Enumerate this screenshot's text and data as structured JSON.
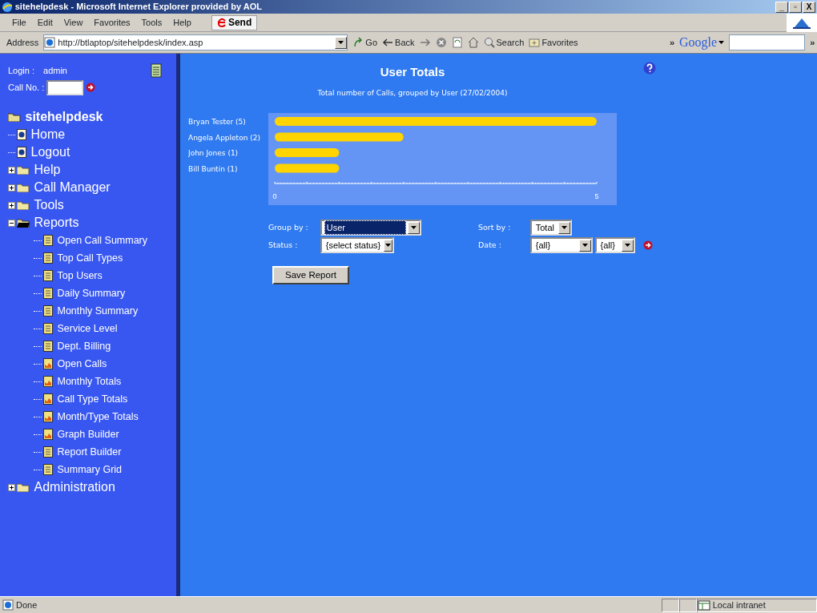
{
  "window": {
    "title": "sitehelpdesk - Microsoft Internet Explorer provided by AOL",
    "controls": [
      "_",
      "▫",
      "X"
    ]
  },
  "menu": [
    "File",
    "Edit",
    "View",
    "Favorites",
    "Tools",
    "Help"
  ],
  "send_button": "Send",
  "address_bar": {
    "label": "Address",
    "url": "http://btlaptop/sitehelpdesk/index.asp",
    "go": "Go",
    "back": "Back",
    "search": "Search",
    "favorites": "Favorites",
    "more": "»",
    "google": "Google",
    "google_more": "»"
  },
  "sidebar": {
    "login_label": "Login :",
    "login_value": "admin",
    "callno_label": "Call No. :",
    "tree": {
      "label": "sitehelpdesk",
      "children": [
        {
          "label": "Home",
          "kind": "page"
        },
        {
          "label": "Logout",
          "kind": "page"
        },
        {
          "label": "Help",
          "kind": "folder",
          "expanded": false
        },
        {
          "label": "Call Manager",
          "kind": "folder",
          "expanded": false
        },
        {
          "label": "Tools",
          "kind": "folder",
          "expanded": false
        },
        {
          "label": "Reports",
          "kind": "folder",
          "expanded": true,
          "children": [
            {
              "label": "Open Call Summary",
              "kind": "report"
            },
            {
              "label": "Top Call Types",
              "kind": "report"
            },
            {
              "label": "Top Users",
              "kind": "report"
            },
            {
              "label": "Daily Summary",
              "kind": "report"
            },
            {
              "label": "Monthly Summary",
              "kind": "report"
            },
            {
              "label": "Service Level",
              "kind": "report"
            },
            {
              "label": "Dept. Billing",
              "kind": "report"
            },
            {
              "label": "Open Calls",
              "kind": "graph"
            },
            {
              "label": "Monthly Totals",
              "kind": "graph"
            },
            {
              "label": "Call Type Totals",
              "kind": "graph"
            },
            {
              "label": "Month/Type Totals",
              "kind": "graph"
            },
            {
              "label": "Graph Builder",
              "kind": "graph"
            },
            {
              "label": "Report Builder",
              "kind": "report"
            },
            {
              "label": "Summary Grid",
              "kind": "report"
            }
          ]
        },
        {
          "label": "Administration",
          "kind": "folder",
          "expanded": false
        }
      ]
    }
  },
  "report": {
    "title": "User Totals",
    "subtitle": "Total number of Calls, grouped by User (27/02/2004)",
    "chart_data": {
      "type": "bar",
      "orientation": "horizontal",
      "categories": [
        "Bryan Tester (5)",
        "Angela Appleton (2)",
        "John Jones (1)",
        "Bill Buntin (1)"
      ],
      "series": [
        {
          "color": "#ffd400",
          "values": [
            5,
            2,
            1,
            1
          ]
        }
      ],
      "xlim": [
        0,
        5
      ],
      "xticks": [
        0,
        5
      ]
    },
    "filters": [
      {
        "label": "Group by :",
        "selects": [
          {
            "value": "User",
            "focused": true
          }
        ]
      },
      {
        "label": "Sort by :",
        "selects": [
          {
            "value": "Total",
            "focused": false
          }
        ]
      },
      {
        "label": "Status :",
        "selects": [
          {
            "value": "{select status}",
            "focused": false
          }
        ]
      },
      {
        "label": "Date :",
        "selects": [
          {
            "value": "{all}",
            "focused": false
          },
          {
            "value": "{all}",
            "focused": false
          }
        ]
      }
    ],
    "save_button": "Save Report"
  },
  "status_bar": {
    "text": "Done",
    "zone": "Local intranet"
  }
}
